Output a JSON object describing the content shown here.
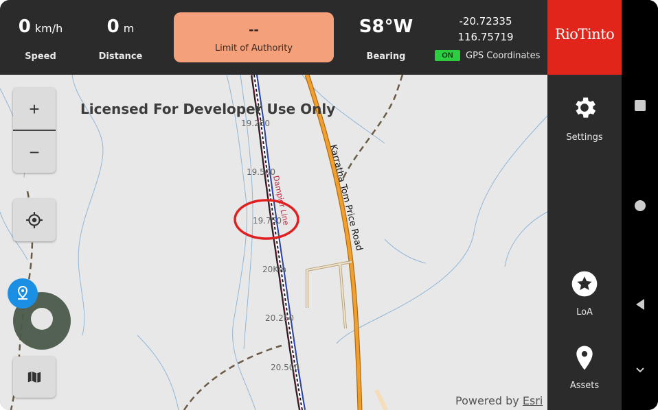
{
  "status": {
    "speed": {
      "value": "0",
      "unit": "km/h",
      "label": "Speed"
    },
    "distance": {
      "value": "0",
      "unit": "m",
      "label": "Distance"
    },
    "limit_of_authority": {
      "value": "--",
      "label": "Limit of Authority"
    },
    "bearing": {
      "value": "S8°W",
      "label": "Bearing"
    },
    "gps": {
      "lat": "-20.72335",
      "lon": "116.75719",
      "status": "ON",
      "label": "GPS Coordinates"
    }
  },
  "brand": {
    "name": "RioTinto"
  },
  "sidebar": {
    "items": [
      {
        "label": "Settings",
        "icon": "gear-icon"
      },
      {
        "label": "LoA",
        "icon": "star-circle-icon"
      },
      {
        "label": "Assets",
        "icon": "location-pin-icon"
      }
    ]
  },
  "map": {
    "watermark": "Licensed For Developer Use Only",
    "attribution_prefix": "Powered by ",
    "attribution_link": "Esri",
    "road_label": "Karratha Tom Price Road",
    "rail_label": "Dampier Line",
    "km_markers": [
      "19.250",
      "19.500",
      "19.750",
      "20Km",
      "20.250",
      "20.500"
    ],
    "zoom_in": "+",
    "zoom_out": "−"
  },
  "colors": {
    "topbar": "#2b2b2b",
    "loa_box": "#f4a07a",
    "brand": "#e1251b",
    "gps_on": "#2ecc40",
    "road": "#f0a030",
    "highlight": "#e02020"
  }
}
